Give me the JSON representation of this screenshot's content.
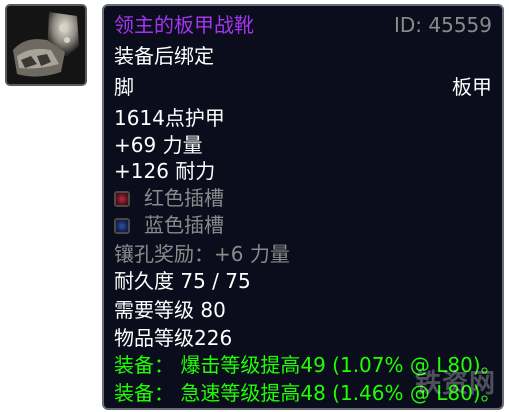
{
  "item": {
    "name": "领主的板甲战靴",
    "id_label": "ID: 45559",
    "binding": "装备后绑定",
    "slot": "脚",
    "armor_type": "板甲",
    "armor": "1614点护甲",
    "stat_strength": "+69 力量",
    "stat_stamina": "+126 耐力",
    "socket_red": "红色插槽",
    "socket_blue": "蓝色插槽",
    "socket_bonus": "镶孔奖励：+6 力量",
    "durability": "耐久度 75 / 75",
    "required_level": "需要等级 80",
    "item_level": "物品等级226",
    "equip_crit": "装备： 爆击等级提高49 (1.07% @ L80)。",
    "equip_haste": "装备： 急速等级提高48 (1.46% @ L80)。"
  },
  "watermark": "铁资网",
  "colors": {
    "epic_name": "#a335ee",
    "equip_green": "#1eff00",
    "grey_text": "#8a8a8a",
    "tooltip_bg": "#0b0d1d"
  }
}
